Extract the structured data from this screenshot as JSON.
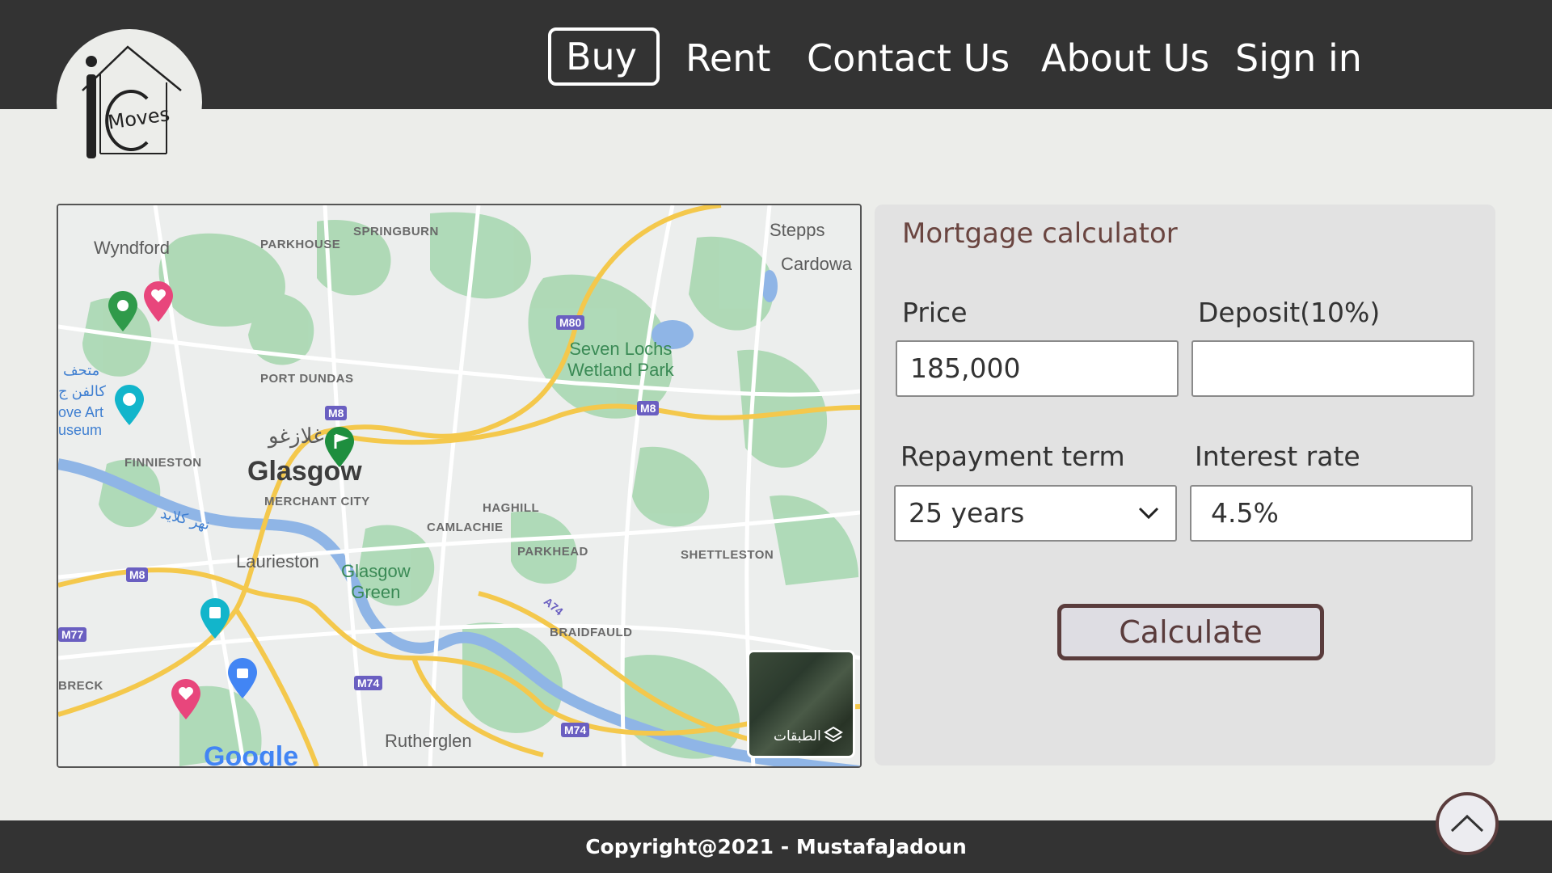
{
  "header": {
    "logo_text": "Moves",
    "nav": [
      {
        "label": "Buy",
        "active": true
      },
      {
        "label": "Rent",
        "active": false
      },
      {
        "label": "Contact Us",
        "active": false
      },
      {
        "label": "About Us",
        "active": false
      },
      {
        "label": "Sign in",
        "active": false
      }
    ]
  },
  "map": {
    "labels": {
      "wyndford": "Wyndford",
      "parkhouse": "PARKHOUSE",
      "springburn": "SPRINGBURN",
      "stepps": "Stepps",
      "cardowan": "Cardowa",
      "seven_lochs": "Seven Lochs\nWetland Park",
      "port_dundas": "PORT DUNDAS",
      "glasgow": "Glasgow",
      "glasgow_arabic": "غلازغو",
      "merchant_city": "MERCHANT CITY",
      "finnieston": "FINNIESTON",
      "haghill": "HAGHILL",
      "camlachie": "CAMLACHIE",
      "parkhead": "PARKHEAD",
      "shettleston": "SHETTLESTON",
      "laurieston": "Laurieston",
      "glasgow_green": "Glasgow\nGreen",
      "braidfauld": "BRAIDFAULD",
      "breck": "BRECK",
      "rutherglen": "Rutherglen",
      "river_arabic": "نهر كلايد",
      "museum_arabic_1": "متحف",
      "museum_arabic_2": "كالفن ج",
      "museum_en_1": "ove Art",
      "museum_en_2": "useum"
    },
    "shields": [
      "M80",
      "M8",
      "M8",
      "M8",
      "M77",
      "M74",
      "M74",
      "A74"
    ],
    "layers_label": "الطبقات",
    "google_logo": "Google"
  },
  "calculator": {
    "title": "Mortgage calculator",
    "price_label": "Price",
    "price_value": "185,000",
    "deposit_label": "Deposit(10%)",
    "deposit_value": "",
    "term_label": "Repayment term",
    "term_value": "25 years",
    "rate_label": "Interest rate",
    "rate_value": "4.5%",
    "button_label": "Calculate"
  },
  "footer": {
    "copyright": "Copyright@2021 - MustafaJadoun"
  },
  "colors": {
    "header_bg": "#333333",
    "page_bg": "#ecedea",
    "accent": "#5a3c3c",
    "title": "#6a4540"
  }
}
